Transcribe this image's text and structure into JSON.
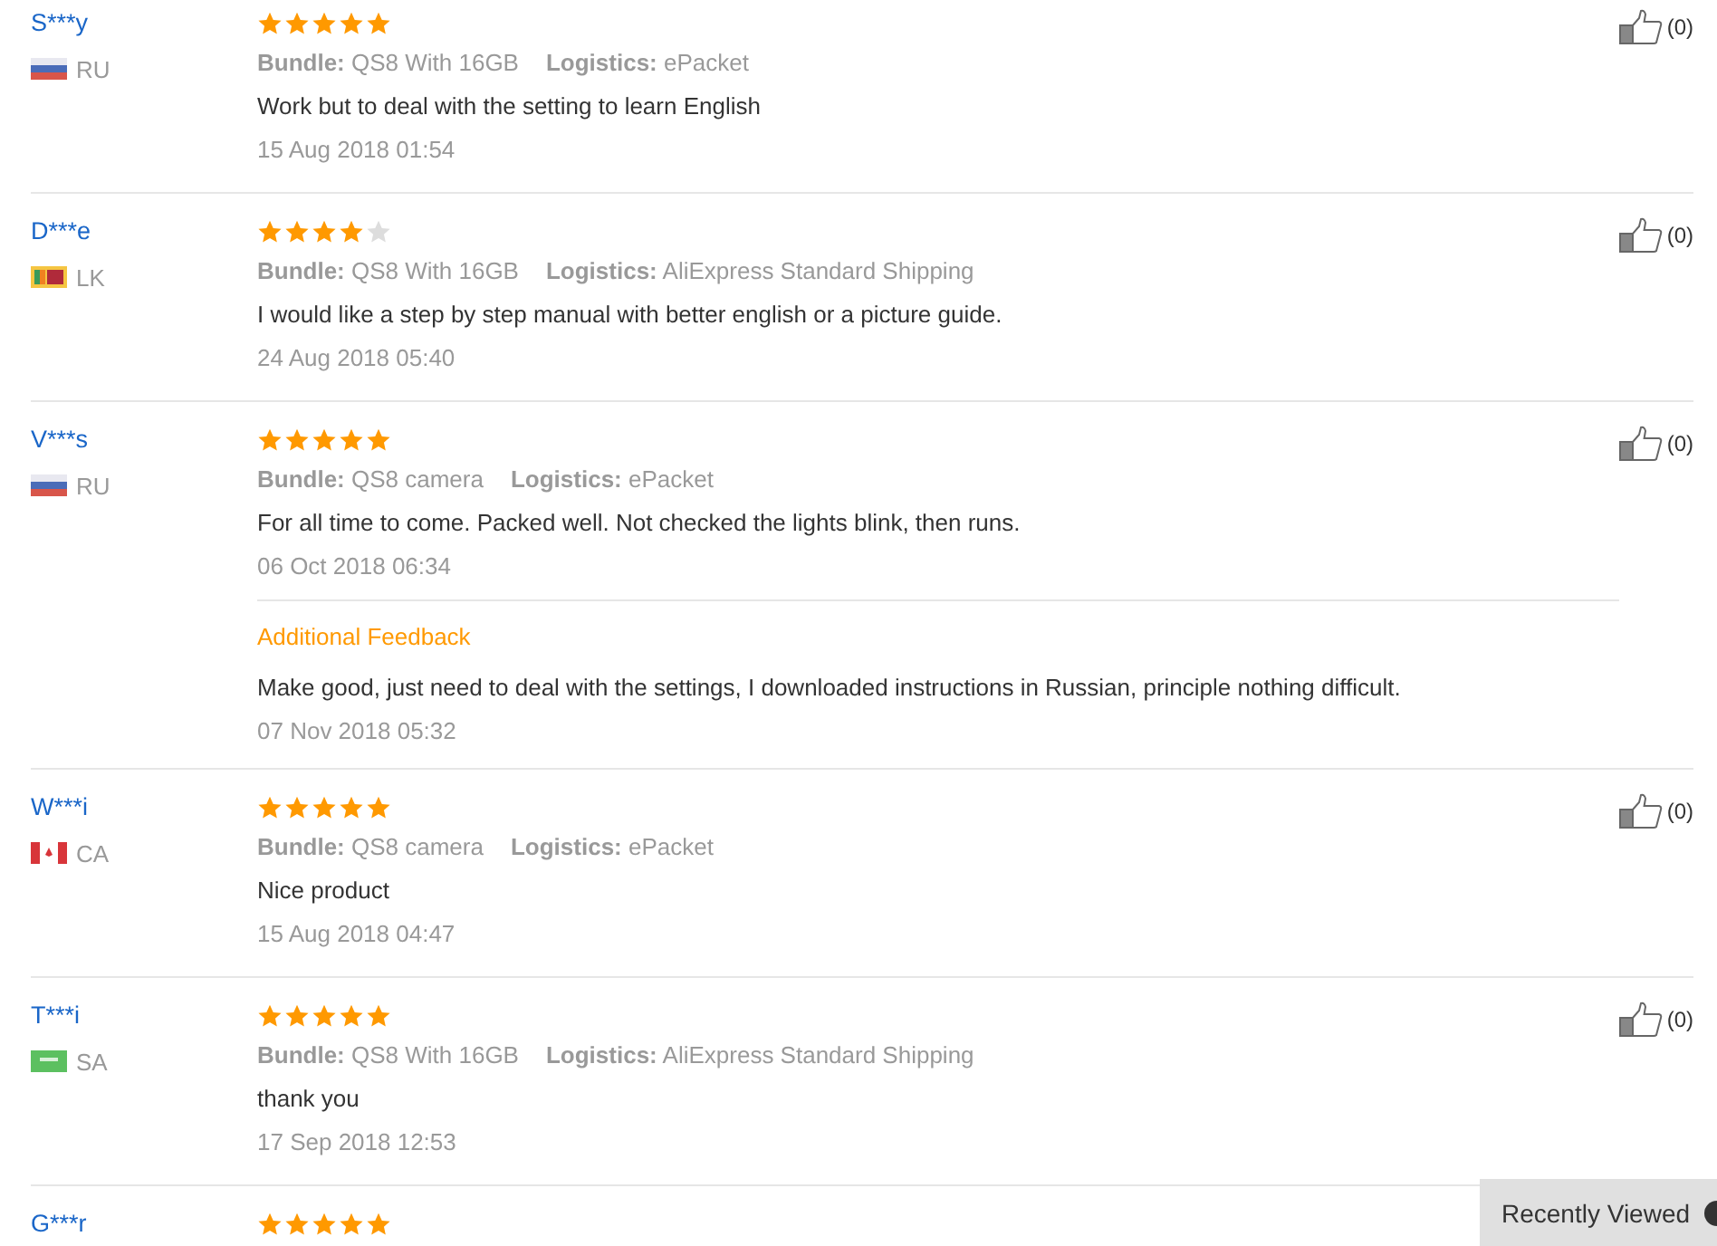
{
  "reviews": [
    {
      "name": "S***y",
      "flag": {
        "kind": "ru"
      },
      "country": "RU",
      "stars": 5,
      "bundle_label": "Bundle:",
      "bundle": "QS8 With 16GB",
      "logistics_label": "Logistics:",
      "logistics": "ePacket",
      "text": "Work but to deal with the setting to learn English",
      "date": "15 Aug 2018 01:54",
      "likes": "(0)"
    },
    {
      "name": "D***e",
      "flag": {
        "kind": "lk"
      },
      "country": "LK",
      "stars": 4,
      "bundle_label": "Bundle:",
      "bundle": "QS8 With 16GB",
      "logistics_label": "Logistics:",
      "logistics": "AliExpress Standard Shipping",
      "text": "I would like a step by step manual with better english or a picture guide.",
      "date": "24 Aug 2018 05:40",
      "likes": "(0)"
    },
    {
      "name": "V***s",
      "flag": {
        "kind": "ru"
      },
      "country": "RU",
      "stars": 5,
      "bundle_label": "Bundle:",
      "bundle": "QS8 camera",
      "logistics_label": "Logistics:",
      "logistics": "ePacket",
      "text": "For all time to come. Packed well. Not checked the lights blink, then runs.",
      "date": "06 Oct 2018 06:34",
      "likes": "(0)",
      "additional": {
        "title": "Additional Feedback",
        "text": "Make good, just need to deal with the settings, I downloaded instructions in Russian, principle nothing difficult.",
        "date": "07 Nov 2018 05:32"
      }
    },
    {
      "name": "W***i",
      "flag": {
        "kind": "ca"
      },
      "country": "CA",
      "stars": 5,
      "bundle_label": "Bundle:",
      "bundle": "QS8 camera",
      "logistics_label": "Logistics:",
      "logistics": "ePacket",
      "text": "Nice product",
      "date": "15 Aug 2018 04:47",
      "likes": "(0)"
    },
    {
      "name": "T***i",
      "flag": {
        "kind": "sa"
      },
      "country": "SA",
      "stars": 5,
      "bundle_label": "Bundle:",
      "bundle": "QS8 With 16GB",
      "logistics_label": "Logistics:",
      "logistics": "AliExpress Standard Shipping",
      "text": "thank you",
      "date": "17 Sep 2018 12:53",
      "likes": "(0)"
    },
    {
      "name": "G***r",
      "stars": 5
    }
  ],
  "recently_viewed": {
    "label": "Recently Viewed"
  }
}
